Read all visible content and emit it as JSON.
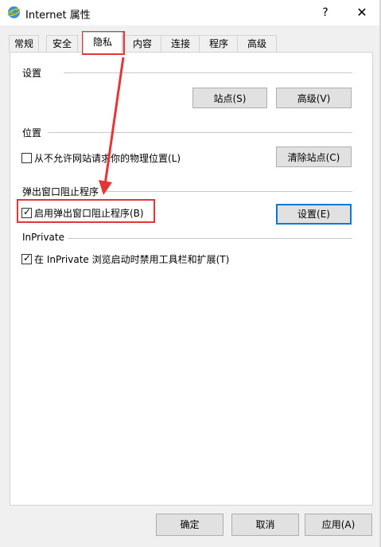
{
  "window": {
    "title": "Internet 属性",
    "help_label": "?",
    "close_label": "✕"
  },
  "tabs": [
    {
      "label": "常规"
    },
    {
      "label": "安全"
    },
    {
      "label": "隐私",
      "active": true
    },
    {
      "label": "内容"
    },
    {
      "label": "连接"
    },
    {
      "label": "程序"
    },
    {
      "label": "高级"
    }
  ],
  "settings_section": {
    "title": "设置",
    "sites_button": "站点(S)",
    "advanced_button": "高级(V)"
  },
  "location_section": {
    "title": "位置",
    "checkbox_label": "从不允许网站请求你的物理位置(L)",
    "checkbox_checked": false,
    "clear_sites_button": "清除站点(C)"
  },
  "popup_section": {
    "title": "弹出窗口阻止程序",
    "checkbox_label": "启用弹出窗口阻止程序(B)",
    "checkbox_checked": true,
    "settings_button": "设置(E)"
  },
  "inprivate_section": {
    "title": "InPrivate",
    "checkbox_label": "在 InPrivate 浏览启动时禁用工具栏和扩展(T)",
    "checkbox_checked": true
  },
  "footer": {
    "ok_button": "确定",
    "cancel_button": "取消",
    "apply_button": "应用(A)"
  },
  "colors": {
    "annotation": "#e53535",
    "focus": "#0078d7"
  },
  "icons": {
    "app": "internet-globe-icon",
    "check": "checkmark-icon"
  }
}
